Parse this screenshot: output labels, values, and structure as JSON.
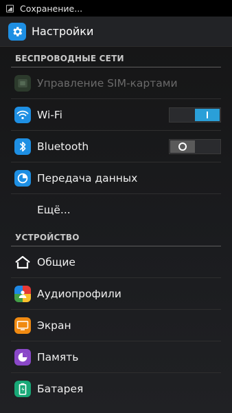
{
  "status_bar": {
    "notification_text": "Сохранение..."
  },
  "action_bar": {
    "title": "Настройки"
  },
  "sections": {
    "wireless": {
      "header": "БЕСПРОВОДНЫЕ СЕТИ",
      "items": {
        "sim": {
          "label": "Управление SIM-картами"
        },
        "wifi": {
          "label": "Wi-Fi",
          "toggle": "on"
        },
        "bluetooth": {
          "label": "Bluetooth",
          "toggle": "off"
        },
        "data": {
          "label": "Передача данных"
        },
        "more": {
          "label": "Ещё..."
        }
      }
    },
    "device": {
      "header": "УСТРОЙСТВО",
      "items": {
        "general": {
          "label": "Общие"
        },
        "audio": {
          "label": "Аудиопрофили"
        },
        "screen": {
          "label": "Экран"
        },
        "memory": {
          "label": "Память"
        },
        "battery": {
          "label": "Батарея"
        }
      }
    }
  },
  "colors": {
    "accent": "#2a9fd8",
    "wifi_icon": "#1e8fe3",
    "screen_icon": "#f08a12",
    "memory_icon": "#8a48c8",
    "battery_icon": "#18a877"
  },
  "icons": [
    "gallery-icon",
    "settings-gear-icon",
    "sim-card-icon",
    "wifi-icon",
    "bluetooth-icon",
    "data-usage-icon",
    "home-icon",
    "audio-profile-icon",
    "display-icon",
    "storage-icon",
    "battery-icon"
  ]
}
